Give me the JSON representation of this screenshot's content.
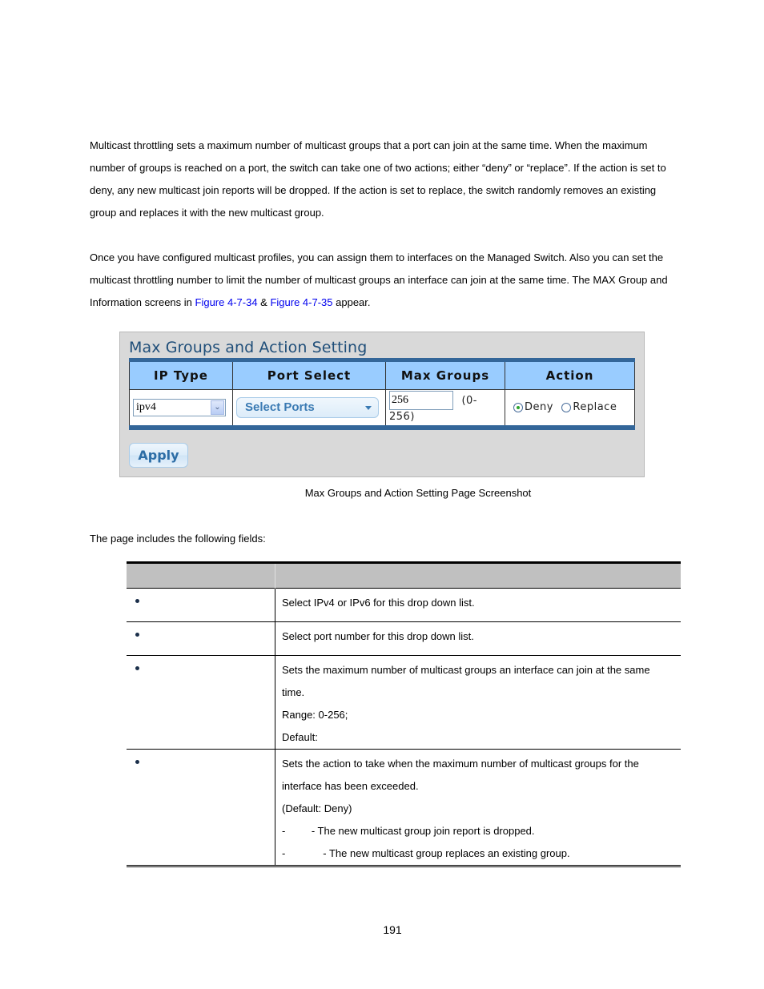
{
  "intro": {
    "paragraph1": "Multicast throttling sets a maximum number of multicast groups that a port can join at the same time. When the maximum number of groups is reached on a port, the switch can take one of two actions; either “deny” or “replace”. If the action is set to deny, any new multicast join reports will be dropped. If the action is set to replace, the switch randomly removes an existing group and replaces it with the new multicast group.",
    "paragraph2_pre": "Once you have configured multicast profiles, you can assign them to interfaces on the Managed Switch. Also you can set the multicast throttling number to limit the number of multicast groups an interface can join at the same time. The MAX Group and Information screens in ",
    "link1": "Figure 4-7-34",
    "amp": " & ",
    "link2": "Figure 4-7-35",
    "paragraph2_post": " appear."
  },
  "panel": {
    "title": "Max Groups and Action Setting",
    "headers": [
      "IP Type",
      "Port Select",
      "Max Groups",
      "Action"
    ],
    "ip_type_value": "ipv4",
    "port_select_placeholder": "Select Ports",
    "max_groups_value": "256",
    "max_groups_range": "(0-256)",
    "action_options": [
      {
        "label": "Deny",
        "selected": true
      },
      {
        "label": "Replace",
        "selected": false
      }
    ],
    "apply_label": "Apply",
    "colors": {
      "header_bg": "#99ccff",
      "border": "#336699",
      "title": "#1f4e79"
    }
  },
  "caption": "Max Groups and Action Setting Page Screenshot",
  "fields_intro": "The page includes the following fields:",
  "fields": {
    "headers": [
      "",
      ""
    ],
    "rows": [
      {
        "object": "",
        "description": [
          "Select IPv4 or IPv6 for this drop down list."
        ]
      },
      {
        "object": "",
        "description": [
          "Select port number for this drop down list."
        ]
      },
      {
        "object": "",
        "description": [
          "Sets the maximum number of multicast groups an interface can join at the same time.",
          "Range: 0-256;",
          "Default:"
        ]
      },
      {
        "object": "",
        "description": [
          "Sets the action to take when the maximum number of multicast groups for the interface has been exceeded.",
          "(Default: Deny)",
          "-         - The new multicast group join report is dropped.",
          "-             - The new multicast group replaces an existing group."
        ]
      }
    ]
  },
  "page_number": "191"
}
